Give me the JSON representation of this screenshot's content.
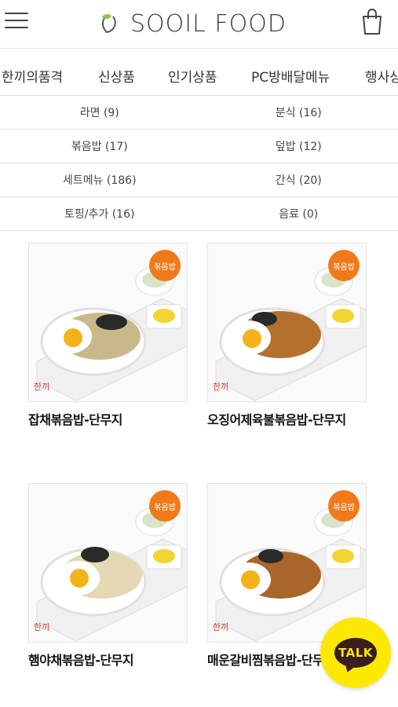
{
  "header": {
    "logo_text": "SOOIL FOOD"
  },
  "tabs": [
    {
      "label": "한끼의품격"
    },
    {
      "label": "신상품"
    },
    {
      "label": "인기상품"
    },
    {
      "label": "PC방배달메뉴"
    },
    {
      "label": "행사상품"
    }
  ],
  "categories": [
    {
      "label": "라면 (9)"
    },
    {
      "label": "분식 (16)"
    },
    {
      "label": "볶음밥 (17)"
    },
    {
      "label": "덮밥 (12)"
    },
    {
      "label": "세트메뉴 (186)"
    },
    {
      "label": "간식 (20)"
    },
    {
      "label": "토핑/추가 (16)"
    },
    {
      "label": "음료 (0)"
    }
  ],
  "products": [
    {
      "name": "잡채볶음밥-단무지",
      "badge": "볶음밥"
    },
    {
      "name": "오징어제육불볶음밥-단무지",
      "badge": "볶음밥"
    },
    {
      "name": "햄야채볶음밥-단무지",
      "badge": "볶음밥"
    },
    {
      "name": "매운갈비찜볶음밥-단무지",
      "badge": "볶음밥"
    }
  ],
  "talk_button": {
    "label": "TALK"
  },
  "colors": {
    "badge": "#f07a1a",
    "talk_bg": "#fce800",
    "talk_bubble": "#3a1d1d",
    "logo_leaf": "#8cc63f"
  }
}
